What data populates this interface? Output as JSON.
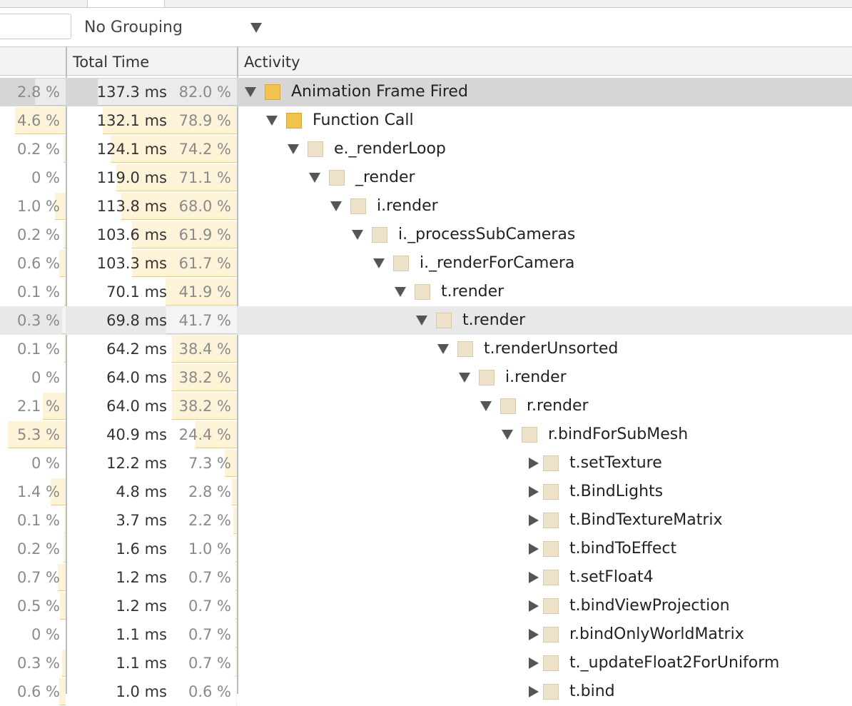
{
  "toolbar": {
    "grouping": "No Grouping"
  },
  "header": {
    "total_time": "Total Time",
    "activity": "Activity"
  },
  "colors": {
    "js_swatch": "#f0c34d",
    "js_swatch_border": "#d9a72c",
    "fn_swatch": "#ede1c9",
    "fn_swatch_border": "#d8c9a8"
  },
  "rows": [
    {
      "self": "2.8 %",
      "time": "137.3 ms",
      "pct": "82.0 %",
      "self_frac": 0.028,
      "total_frac": 0.82,
      "name": "Animation Frame Fired",
      "depth": 0,
      "expanded": true,
      "swatch": "js",
      "state": "selected"
    },
    {
      "self": "4.6 %",
      "time": "132.1 ms",
      "pct": "78.9 %",
      "self_frac": 0.046,
      "total_frac": 0.789,
      "name": "Function Call",
      "depth": 1,
      "expanded": true,
      "swatch": "js",
      "state": ""
    },
    {
      "self": "0.2 %",
      "time": "124.1 ms",
      "pct": "74.2 %",
      "self_frac": 0.002,
      "total_frac": 0.742,
      "name": "e._renderLoop",
      "depth": 2,
      "expanded": true,
      "swatch": "fn",
      "state": ""
    },
    {
      "self": "0 %",
      "time": "119.0 ms",
      "pct": "71.1 %",
      "self_frac": 0.0,
      "total_frac": 0.711,
      "name": "_render",
      "depth": 3,
      "expanded": true,
      "swatch": "fn",
      "state": ""
    },
    {
      "self": "1.0 %",
      "time": "113.8 ms",
      "pct": "68.0 %",
      "self_frac": 0.01,
      "total_frac": 0.68,
      "name": "i.render",
      "depth": 4,
      "expanded": true,
      "swatch": "fn",
      "state": ""
    },
    {
      "self": "0.2 %",
      "time": "103.6 ms",
      "pct": "61.9 %",
      "self_frac": 0.002,
      "total_frac": 0.619,
      "name": "i._processSubCameras",
      "depth": 5,
      "expanded": true,
      "swatch": "fn",
      "state": ""
    },
    {
      "self": "0.6 %",
      "time": "103.3 ms",
      "pct": "61.7 %",
      "self_frac": 0.006,
      "total_frac": 0.617,
      "name": "i._renderForCamera",
      "depth": 6,
      "expanded": true,
      "swatch": "fn",
      "state": ""
    },
    {
      "self": "0.1 %",
      "time": "70.1 ms",
      "pct": "41.9 %",
      "self_frac": 0.001,
      "total_frac": 0.419,
      "name": "t.render",
      "depth": 7,
      "expanded": true,
      "swatch": "fn",
      "state": ""
    },
    {
      "self": "0.3 %",
      "time": "69.8 ms",
      "pct": "41.7 %",
      "self_frac": 0.003,
      "total_frac": 0.417,
      "name": "t.render",
      "depth": 8,
      "expanded": true,
      "swatch": "fn",
      "state": "hovered"
    },
    {
      "self": "0.1 %",
      "time": "64.2 ms",
      "pct": "38.4 %",
      "self_frac": 0.001,
      "total_frac": 0.384,
      "name": "t.renderUnsorted",
      "depth": 9,
      "expanded": true,
      "swatch": "fn",
      "state": ""
    },
    {
      "self": "0 %",
      "time": "64.0 ms",
      "pct": "38.2 %",
      "self_frac": 0.0,
      "total_frac": 0.382,
      "name": "i.render",
      "depth": 10,
      "expanded": true,
      "swatch": "fn",
      "state": ""
    },
    {
      "self": "2.1 %",
      "time": "64.0 ms",
      "pct": "38.2 %",
      "self_frac": 0.021,
      "total_frac": 0.382,
      "name": "r.render",
      "depth": 11,
      "expanded": true,
      "swatch": "fn",
      "state": ""
    },
    {
      "self": "5.3 %",
      "time": "40.9 ms",
      "pct": "24.4 %",
      "self_frac": 0.053,
      "total_frac": 0.244,
      "name": "r.bindForSubMesh",
      "depth": 12,
      "expanded": true,
      "swatch": "fn",
      "state": ""
    },
    {
      "self": "0 %",
      "time": "12.2 ms",
      "pct": "7.3 %",
      "self_frac": 0.0,
      "total_frac": 0.073,
      "name": "t.setTexture",
      "depth": 13,
      "expanded": false,
      "swatch": "fn",
      "state": ""
    },
    {
      "self": "1.4 %",
      "time": "4.8 ms",
      "pct": "2.8 %",
      "self_frac": 0.014,
      "total_frac": 0.028,
      "name": "t.BindLights",
      "depth": 13,
      "expanded": false,
      "swatch": "fn",
      "state": ""
    },
    {
      "self": "0.1 %",
      "time": "3.7 ms",
      "pct": "2.2 %",
      "self_frac": 0.001,
      "total_frac": 0.022,
      "name": "t.BindTextureMatrix",
      "depth": 13,
      "expanded": false,
      "swatch": "fn",
      "state": ""
    },
    {
      "self": "0.2 %",
      "time": "1.6 ms",
      "pct": "1.0 %",
      "self_frac": 0.002,
      "total_frac": 0.01,
      "name": "t.bindToEffect",
      "depth": 13,
      "expanded": false,
      "swatch": "fn",
      "state": ""
    },
    {
      "self": "0.7 %",
      "time": "1.2 ms",
      "pct": "0.7 %",
      "self_frac": 0.007,
      "total_frac": 0.007,
      "name": "t.setFloat4",
      "depth": 13,
      "expanded": false,
      "swatch": "fn",
      "state": ""
    },
    {
      "self": "0.5 %",
      "time": "1.2 ms",
      "pct": "0.7 %",
      "self_frac": 0.005,
      "total_frac": 0.007,
      "name": "t.bindViewProjection",
      "depth": 13,
      "expanded": false,
      "swatch": "fn",
      "state": ""
    },
    {
      "self": "0 %",
      "time": "1.1 ms",
      "pct": "0.7 %",
      "self_frac": 0.0,
      "total_frac": 0.007,
      "name": "r.bindOnlyWorldMatrix",
      "depth": 13,
      "expanded": false,
      "swatch": "fn",
      "state": ""
    },
    {
      "self": "0.3 %",
      "time": "1.1 ms",
      "pct": "0.7 %",
      "self_frac": 0.003,
      "total_frac": 0.007,
      "name": "t._updateFloat2ForUniform",
      "depth": 13,
      "expanded": false,
      "swatch": "fn",
      "state": ""
    },
    {
      "self": "0.6 %",
      "time": "1.0 ms",
      "pct": "0.6 %",
      "self_frac": 0.006,
      "total_frac": 0.006,
      "name": "t.bind",
      "depth": 13,
      "expanded": false,
      "swatch": "fn",
      "state": ""
    }
  ]
}
